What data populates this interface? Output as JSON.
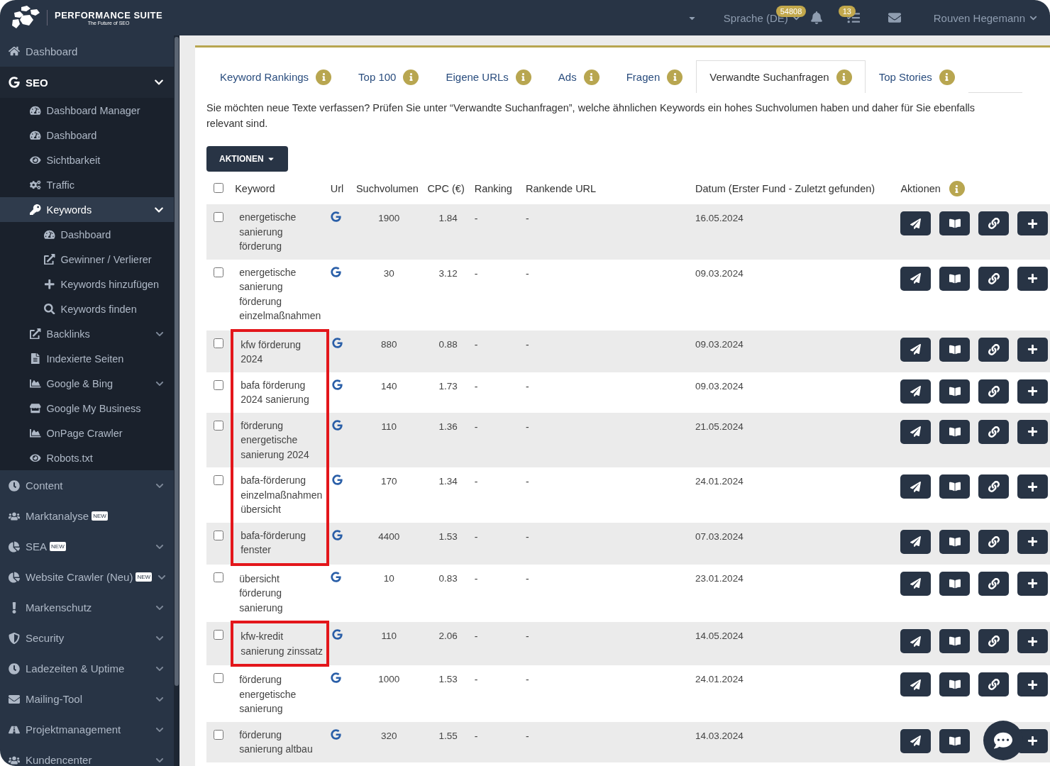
{
  "header": {
    "brand": "PERFORMANCE SUITE",
    "tagline": "The Future of SEO",
    "language": "Sprache (DE)",
    "notifications_count": "54808",
    "tasks_count": "13",
    "user": "Rouven Hegemann"
  },
  "sidebar": {
    "items": [
      {
        "label": "Dashboard",
        "selected": false
      },
      {
        "label": "SEO",
        "selected": true,
        "expanded": true,
        "children": [
          {
            "label": "Dashboard Manager",
            "selected": false
          },
          {
            "label": "Dashboard",
            "selected": false
          },
          {
            "label": "Sichtbarkeit",
            "selected": false
          },
          {
            "label": "Traffic",
            "selected": false
          },
          {
            "label": "Keywords",
            "selected": true,
            "expanded": true,
            "children": [
              {
                "label": "Dashboard",
                "selected": false
              },
              {
                "label": "Gewinner / Verlierer",
                "selected": false
              },
              {
                "label": "Keywords hinzufügen",
                "selected": false
              },
              {
                "label": "Keywords finden",
                "selected": false
              }
            ]
          },
          {
            "label": "Backlinks",
            "selected": false,
            "expanded": false
          },
          {
            "label": "Indexierte Seiten",
            "selected": false
          },
          {
            "label": "Google & Bing",
            "selected": false,
            "expanded": false
          },
          {
            "label": "Google My Business",
            "selected": false
          },
          {
            "label": "OnPage Crawler",
            "selected": false
          },
          {
            "label": "Robots.txt",
            "selected": false
          }
        ]
      },
      {
        "label": "Content",
        "selected": false,
        "expanded": false
      },
      {
        "label": "Marktanalyse",
        "selected": false,
        "badge": "NEW"
      },
      {
        "label": "SEA",
        "selected": false,
        "badge": "NEW",
        "expanded": false
      },
      {
        "label": "Website Crawler (Neu)",
        "selected": false,
        "badge": "NEW",
        "expanded": false
      },
      {
        "label": "Markenschutz",
        "selected": false,
        "expanded": false
      },
      {
        "label": "Security",
        "selected": false,
        "expanded": false
      },
      {
        "label": "Ladezeiten & Uptime",
        "selected": false,
        "expanded": false
      },
      {
        "label": "Mailing-Tool",
        "selected": false,
        "expanded": false
      },
      {
        "label": "Projektmanagement",
        "selected": false,
        "expanded": false
      },
      {
        "label": "Kundencenter",
        "selected": false,
        "expanded": false
      }
    ]
  },
  "tabs": [
    {
      "label": "Keyword Rankings",
      "selected": false
    },
    {
      "label": "Top 100",
      "selected": false
    },
    {
      "label": "Eigene URLs",
      "selected": false
    },
    {
      "label": "Ads",
      "selected": false
    },
    {
      "label": "Fragen",
      "selected": false
    },
    {
      "label": "Verwandte Suchanfragen",
      "selected": true
    },
    {
      "label": "Top Stories",
      "selected": false
    }
  ],
  "intro": "Sie möchten neue Texte verfassen? Prüfen Sie unter “Verwandte Suchanfragen”, welche ähnlichen Keywords ein hohes Suchvolumen haben und daher für Sie ebenfalls relevant sind.",
  "actions_button": "AKTIONEN",
  "table": {
    "select_all_checked": false,
    "columns": [
      "Keyword",
      "Url",
      "Suchvolumen",
      "CPC (€)",
      "Ranking",
      "Rankende URL",
      "Datum (Erster Fund - Zuletzt gefunden)",
      "Aktionen"
    ],
    "rows": [
      {
        "checked": false,
        "highlighted": false,
        "keyword": "energetische sanierung förderung",
        "volume": "1900",
        "cpc": "1.84",
        "ranking": "-",
        "ranking_url": "-",
        "date": "16.05.2024"
      },
      {
        "checked": false,
        "highlighted": false,
        "keyword": "energetische sanierung förderung einzelmaßnahmen",
        "volume": "30",
        "cpc": "3.12",
        "ranking": "-",
        "ranking_url": "-",
        "date": "09.03.2024"
      },
      {
        "checked": false,
        "highlighted": true,
        "keyword": "kfw förderung 2024",
        "volume": "880",
        "cpc": "0.88",
        "ranking": "-",
        "ranking_url": "-",
        "date": "09.03.2024"
      },
      {
        "checked": false,
        "highlighted": true,
        "keyword": "bafa förderung 2024 sanierung",
        "volume": "140",
        "cpc": "1.73",
        "ranking": "-",
        "ranking_url": "-",
        "date": "09.03.2024"
      },
      {
        "checked": false,
        "highlighted": true,
        "keyword": "förderung energetische sanierung 2024",
        "volume": "110",
        "cpc": "1.36",
        "ranking": "-",
        "ranking_url": "-",
        "date": "21.05.2024"
      },
      {
        "checked": false,
        "highlighted": true,
        "keyword": "bafa-förderung einzelmaßnahmen übersicht",
        "volume": "170",
        "cpc": "1.34",
        "ranking": "-",
        "ranking_url": "-",
        "date": "24.01.2024"
      },
      {
        "checked": false,
        "highlighted": true,
        "keyword": "bafa-förderung fenster",
        "volume": "4400",
        "cpc": "1.53",
        "ranking": "-",
        "ranking_url": "-",
        "date": "07.03.2024"
      },
      {
        "checked": false,
        "highlighted": false,
        "keyword": "übersicht förderung sanierung",
        "volume": "10",
        "cpc": "0.83",
        "ranking": "-",
        "ranking_url": "-",
        "date": "23.01.2024"
      },
      {
        "checked": false,
        "highlighted": true,
        "keyword": "kfw-kredit sanierung zinssatz",
        "volume": "110",
        "cpc": "2.06",
        "ranking": "-",
        "ranking_url": "-",
        "date": "14.05.2024"
      },
      {
        "checked": false,
        "highlighted": false,
        "keyword": "förderung energetische sanierung",
        "volume": "1000",
        "cpc": "1.53",
        "ranking": "-",
        "ranking_url": "-",
        "date": "24.01.2024"
      },
      {
        "checked": false,
        "highlighted": false,
        "keyword": "förderung sanierung altbau",
        "volume": "320",
        "cpc": "1.55",
        "ranking": "-",
        "ranking_url": "-",
        "date": "14.03.2024"
      }
    ]
  }
}
